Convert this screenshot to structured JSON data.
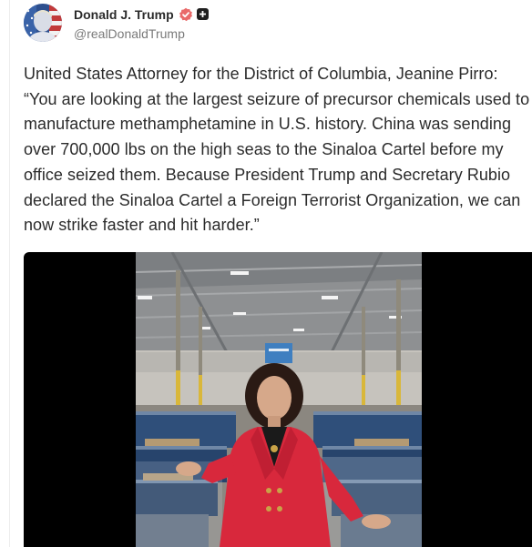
{
  "author": {
    "display_name": "Donald J. Trump",
    "handle": "@realDonaldTrump",
    "verified_icon": "verified-badge-icon",
    "platform_icon": "truth-social-plus-icon",
    "badge_color": "#e96a6a"
  },
  "post": {
    "text": "United States Attorney for the District of Columbia, Jeanine Pirro: “You are looking at the largest seizure of precursor chemicals used to manufacture methamphetamine in U.S. history. China was sending over 700,000 lbs on the high seas to the Sinaloa Cartel before my office seized them. Because President Trump and Secretary Rubio declared the Sinaloa Cartel a Foreign Terrorist Organization, we can now strike faster and hit harder.”"
  },
  "media": {
    "type": "video",
    "background": "#000000",
    "accent_color": "#d8283c"
  }
}
